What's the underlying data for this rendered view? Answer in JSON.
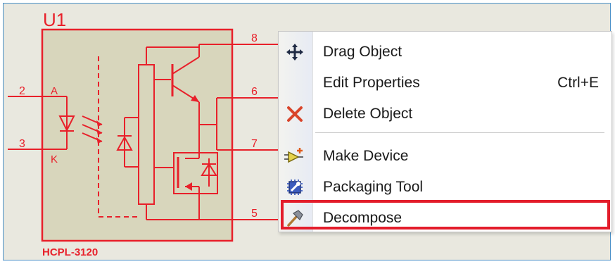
{
  "schematic": {
    "part_ref": "U1",
    "part_value": "HCPL-3120",
    "pins": {
      "p2": "2",
      "p3": "3",
      "p8": "8",
      "p6": "6",
      "p7": "7",
      "p5": "5",
      "anode": "A",
      "cathode": "K"
    },
    "stroke_color": "#e8202a",
    "body_fill": "#d8d6bc"
  },
  "context_menu": {
    "items": [
      {
        "label": "Drag Object",
        "shortcut": "",
        "icon": "move-arrows-icon"
      },
      {
        "label": "Edit Properties",
        "shortcut": "Ctrl+E",
        "icon": ""
      },
      {
        "label": "Delete Object",
        "shortcut": "",
        "icon": "delete-x-icon"
      },
      {
        "label": "Make Device",
        "shortcut": "",
        "icon": "make-device-icon"
      },
      {
        "label": "Packaging Tool",
        "shortcut": "",
        "icon": "packaging-tool-icon"
      },
      {
        "label": "Decompose",
        "shortcut": "",
        "icon": "hammer-icon"
      }
    ],
    "highlighted_item": "Decompose",
    "highlight_color": "#e31d2b"
  }
}
